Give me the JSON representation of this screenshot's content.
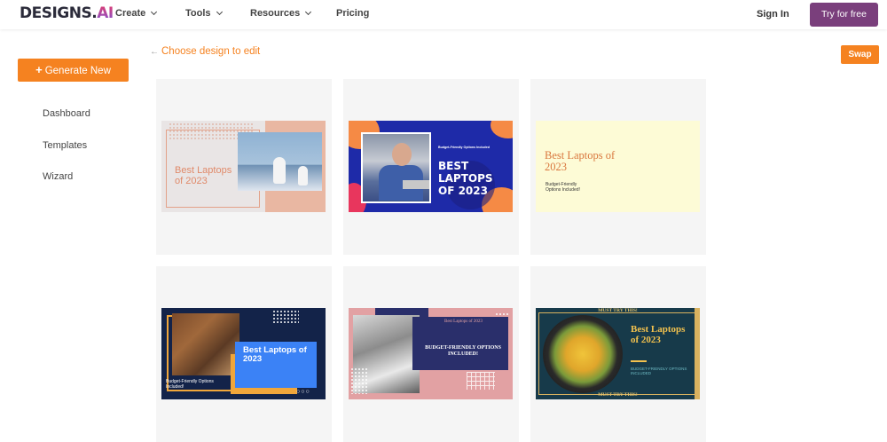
{
  "nav": {
    "logo_main": "DESIGNS.",
    "logo_ai": "AI",
    "menu": [
      {
        "label": "Create",
        "has_dropdown": true
      },
      {
        "label": "Tools",
        "has_dropdown": true
      },
      {
        "label": "Resources",
        "has_dropdown": true
      },
      {
        "label": "Pricing",
        "has_dropdown": false
      }
    ],
    "signin": "Sign In",
    "try_free": "Try for free"
  },
  "sidebar": {
    "generate_label": "Generate New",
    "items": [
      "Dashboard",
      "Templates",
      "Wizard"
    ]
  },
  "main": {
    "back_label": "Choose design to edit",
    "swap_label": "Swap",
    "designs": [
      {
        "title": "Best Laptops of 2023"
      },
      {
        "small": "Budget-Friendly Options Included",
        "title": "BEST LAPTOPS OF 2023"
      },
      {
        "title": "Best Laptops of 2023",
        "sub": "Budget-Friendly Options Included!"
      },
      {
        "title": "Best Laptops of 2023",
        "sub": "Budget-Friendly Options Included!"
      },
      {
        "small": "Best Laptops of 2023",
        "title": "BUDGET-FRIENDLY OPTIONS INCLUDED!"
      },
      {
        "top": "MUST TRY THIS!",
        "title": "Best Laptops of 2023",
        "sub": "BUDGET-FRIENDLY OPTIONS INCLUDED",
        "bottom": "MUST TRY THIS!"
      }
    ]
  },
  "colors": {
    "accent_orange": "#f58220",
    "try_free_bg": "#7a3f7c"
  }
}
